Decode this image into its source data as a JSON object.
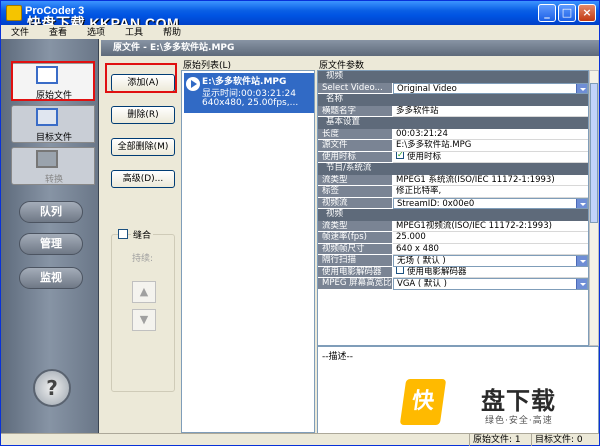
{
  "window": {
    "title": "ProCoder 3",
    "watermark": "快盘下载 KKPAN.COM"
  },
  "menu": [
    "文件",
    "查看",
    "选项",
    "工具",
    "帮助"
  ],
  "nav": {
    "source": "原始文件",
    "target": "目标文件",
    "convert": "转换",
    "queue": "队列",
    "manage": "管理",
    "monitor": "监视",
    "help_icon": "?"
  },
  "header": {
    "title": "原文件 - E:\\多多软件站.MPG"
  },
  "buttons": {
    "add": "添加(A)",
    "remove": "删除(R)",
    "remove_all": "全部删除(M)",
    "advanced": "高级(D)...",
    "stitch": "缝合",
    "duration": "持续:"
  },
  "list": {
    "label": "原始列表(L)",
    "items": [
      {
        "name": "E:\\多多软件站.MPG",
        "line1": "显示时间:00:03:21:24",
        "line2": "640x480, 25.00fps,..."
      }
    ]
  },
  "props": {
    "label": "原文件参数",
    "rows": [
      {
        "type": "section",
        "text": "视频"
      },
      {
        "type": "select",
        "key": "Select Video...",
        "value": "Original Video"
      },
      {
        "type": "section",
        "text": "名称"
      },
      {
        "type": "kv",
        "key": "横题名字",
        "value": "多多软件站"
      },
      {
        "type": "section",
        "text": "基本设置"
      },
      {
        "type": "kv",
        "key": "长度",
        "value": "00:03:21:24"
      },
      {
        "type": "kv",
        "key": "源文件",
        "value": "E:\\多多软件站.MPG"
      },
      {
        "type": "check",
        "key": "使用时标",
        "value": "使用时标",
        "checked": true
      },
      {
        "type": "section",
        "text": "节目/系统流"
      },
      {
        "type": "kv",
        "key": "流类型",
        "value": "MPEG1 系统流(ISO/IEC 11172-1:1993)"
      },
      {
        "type": "kv",
        "key": "标签",
        "value": "修正比特率,"
      },
      {
        "type": "select",
        "key": "视频流",
        "value": "StreamID: 0x00e0"
      },
      {
        "type": "section",
        "text": "视频"
      },
      {
        "type": "kv",
        "key": "流类型",
        "value": "MPEG1视频流(ISO/IEC 11172-2:1993)"
      },
      {
        "type": "kv",
        "key": "帧速率(fps)",
        "value": "25.000"
      },
      {
        "type": "kv",
        "key": "视频帧尺寸",
        "value": "640 x 480"
      },
      {
        "type": "select",
        "key": "隔行扫描",
        "value": "无场 ( 默认 )"
      },
      {
        "type": "check",
        "key": "使用电影解码器",
        "value": "使用电影解码器",
        "checked": false
      },
      {
        "type": "select",
        "key": "MPEG 屏幕高宽比",
        "value": "VGA ( 默认 )"
      }
    ],
    "description": "--描述--"
  },
  "logo": {
    "mark": "快",
    "name": "盘下载",
    "slogan": "绿色·安全·高速"
  },
  "status": {
    "source_files": "原始文件: 1",
    "target_files": "目标文件: 0"
  },
  "colors": {
    "title_blue": "#0054e3",
    "highlight": "#e01010",
    "selection": "#316ac5"
  }
}
